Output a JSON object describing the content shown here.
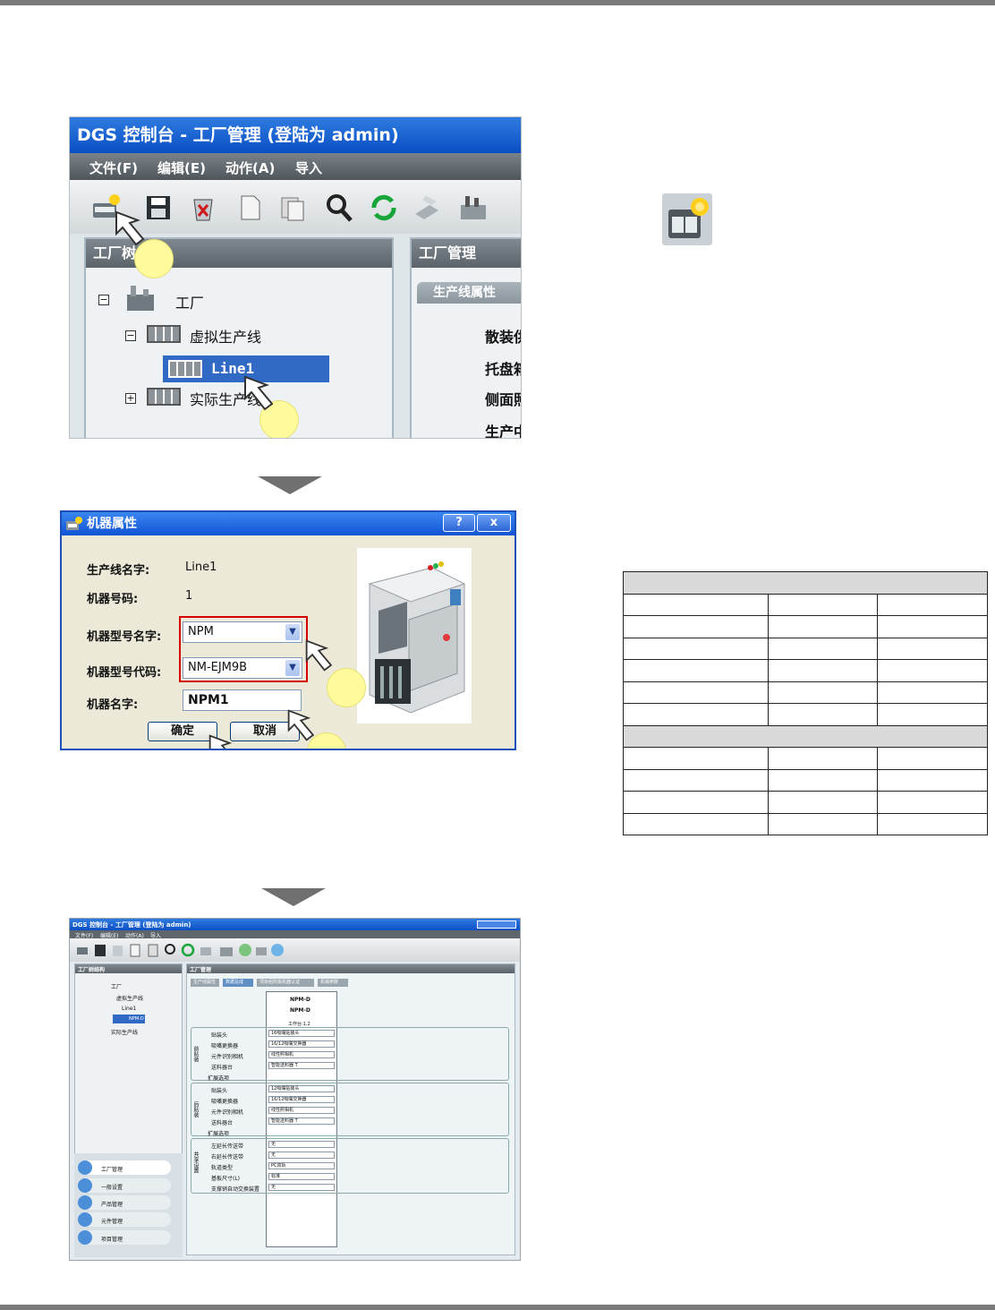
{
  "screenshot1": {
    "title": "DGS 控制台 - 工厂管理 (登陆为 admin)",
    "menus": [
      "文件(F)",
      "编辑(E)",
      "动作(A)",
      "导入"
    ],
    "tree_panel_title": "工厂树结构",
    "tree_root": "工厂",
    "tree_virtual": "虚拟生产线",
    "tree_line": "Line1",
    "tree_actual": "实际生产线",
    "right_panel_title": "工厂管理",
    "right_tab": "生产线属性",
    "right_items": [
      "散装供",
      "托盘箱",
      "侧面照",
      "生产中"
    ]
  },
  "dialog": {
    "title": "机器属性",
    "help_glyph": "?",
    "close_glyph": "x",
    "line_name_label": "生产线名字:",
    "line_name_value": "Line1",
    "machine_no_label": "机器号码:",
    "machine_no_value": "1",
    "model_name_label": "机器型号名字:",
    "model_name_value": "NPM",
    "model_code_label": "机器型号代码:",
    "model_code_value": "NM-EJM9B",
    "machine_name_label": "机器名字:",
    "machine_name_value": "NPM1",
    "ok_label": "确定",
    "cancel_label": "取消"
  },
  "screenshot3": {
    "title": "DGS 控制台 - 工厂管理 (登陆为 admin)",
    "menus": [
      "文件(F)",
      "编辑(E)",
      "动作(A)",
      "导入"
    ],
    "tree_panel_title": "工厂树结构",
    "tree_root": "工厂",
    "tree_virtual": "虚拟生产线",
    "tree_line": "Line1",
    "tree_machine": "NPM-D",
    "tree_actual": "实际生产线",
    "right_panel_title": "工厂管理",
    "tabs": [
      "生产线属性",
      "数据总成",
      "项目组所属机器认证",
      "机械参数"
    ],
    "machine_header": [
      "NPM-D",
      "NPM-D",
      "工作台:1,2"
    ],
    "front_group": "前贴装",
    "rear_group": "后贴装",
    "common_group": "共享设置",
    "front_rows": [
      {
        "label": "贴装头",
        "value": "16吸嘴贴装头"
      },
      {
        "label": "吸嘴更换器",
        "value": "16/12吸嘴交换器"
      },
      {
        "label": "元件识别相机",
        "value": "线性照相机"
      },
      {
        "label": "送料器台",
        "value": "智能送料器 T"
      }
    ],
    "rear_rows": [
      {
        "label": "贴装头",
        "value": "12吸嘴贴装头"
      },
      {
        "label": "吸嘴更换器",
        "value": "16/12吸嘴交换器"
      },
      {
        "label": "元件识别相机",
        "value": "线性照相机"
      },
      {
        "label": "送料器台",
        "value": "智能送料器 T"
      }
    ],
    "common_rows": [
      {
        "label": "左延长传送带",
        "value": "无"
      },
      {
        "label": "右延长传送带",
        "value": "无"
      },
      {
        "label": "轨道类型",
        "value": "PC双轨"
      },
      {
        "label": "基板尺寸(L)",
        "value": "标准"
      },
      {
        "label": "支撑销自动交换装置",
        "value": "无"
      }
    ],
    "expand_label": "扩展选项",
    "nav_items": [
      "工厂管理",
      "一般设置",
      "产品管理",
      "元件管理",
      "项目管理"
    ]
  },
  "colors": {
    "xp_title": "#0a4fc4",
    "badge": "#fffb9c",
    "highlight_box": "#d40000",
    "arrow_gray": "#707070"
  }
}
